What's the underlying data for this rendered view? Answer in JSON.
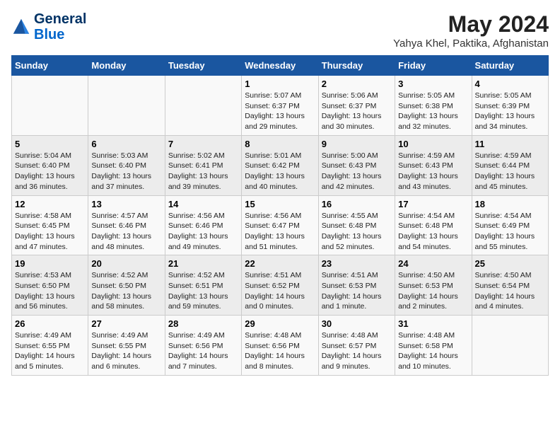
{
  "logo": {
    "line1": "General",
    "line2": "Blue"
  },
  "title": "May 2024",
  "subtitle": "Yahya Khel, Paktika, Afghanistan",
  "days_of_week": [
    "Sunday",
    "Monday",
    "Tuesday",
    "Wednesday",
    "Thursday",
    "Friday",
    "Saturday"
  ],
  "weeks": [
    [
      {
        "day": "",
        "content": ""
      },
      {
        "day": "",
        "content": ""
      },
      {
        "day": "",
        "content": ""
      },
      {
        "day": "1",
        "content": "Sunrise: 5:07 AM\nSunset: 6:37 PM\nDaylight: 13 hours\nand 29 minutes."
      },
      {
        "day": "2",
        "content": "Sunrise: 5:06 AM\nSunset: 6:37 PM\nDaylight: 13 hours\nand 30 minutes."
      },
      {
        "day": "3",
        "content": "Sunrise: 5:05 AM\nSunset: 6:38 PM\nDaylight: 13 hours\nand 32 minutes."
      },
      {
        "day": "4",
        "content": "Sunrise: 5:05 AM\nSunset: 6:39 PM\nDaylight: 13 hours\nand 34 minutes."
      }
    ],
    [
      {
        "day": "5",
        "content": "Sunrise: 5:04 AM\nSunset: 6:40 PM\nDaylight: 13 hours\nand 36 minutes."
      },
      {
        "day": "6",
        "content": "Sunrise: 5:03 AM\nSunset: 6:40 PM\nDaylight: 13 hours\nand 37 minutes."
      },
      {
        "day": "7",
        "content": "Sunrise: 5:02 AM\nSunset: 6:41 PM\nDaylight: 13 hours\nand 39 minutes."
      },
      {
        "day": "8",
        "content": "Sunrise: 5:01 AM\nSunset: 6:42 PM\nDaylight: 13 hours\nand 40 minutes."
      },
      {
        "day": "9",
        "content": "Sunrise: 5:00 AM\nSunset: 6:43 PM\nDaylight: 13 hours\nand 42 minutes."
      },
      {
        "day": "10",
        "content": "Sunrise: 4:59 AM\nSunset: 6:43 PM\nDaylight: 13 hours\nand 43 minutes."
      },
      {
        "day": "11",
        "content": "Sunrise: 4:59 AM\nSunset: 6:44 PM\nDaylight: 13 hours\nand 45 minutes."
      }
    ],
    [
      {
        "day": "12",
        "content": "Sunrise: 4:58 AM\nSunset: 6:45 PM\nDaylight: 13 hours\nand 47 minutes."
      },
      {
        "day": "13",
        "content": "Sunrise: 4:57 AM\nSunset: 6:46 PM\nDaylight: 13 hours\nand 48 minutes."
      },
      {
        "day": "14",
        "content": "Sunrise: 4:56 AM\nSunset: 6:46 PM\nDaylight: 13 hours\nand 49 minutes."
      },
      {
        "day": "15",
        "content": "Sunrise: 4:56 AM\nSunset: 6:47 PM\nDaylight: 13 hours\nand 51 minutes."
      },
      {
        "day": "16",
        "content": "Sunrise: 4:55 AM\nSunset: 6:48 PM\nDaylight: 13 hours\nand 52 minutes."
      },
      {
        "day": "17",
        "content": "Sunrise: 4:54 AM\nSunset: 6:48 PM\nDaylight: 13 hours\nand 54 minutes."
      },
      {
        "day": "18",
        "content": "Sunrise: 4:54 AM\nSunset: 6:49 PM\nDaylight: 13 hours\nand 55 minutes."
      }
    ],
    [
      {
        "day": "19",
        "content": "Sunrise: 4:53 AM\nSunset: 6:50 PM\nDaylight: 13 hours\nand 56 minutes."
      },
      {
        "day": "20",
        "content": "Sunrise: 4:52 AM\nSunset: 6:50 PM\nDaylight: 13 hours\nand 58 minutes."
      },
      {
        "day": "21",
        "content": "Sunrise: 4:52 AM\nSunset: 6:51 PM\nDaylight: 13 hours\nand 59 minutes."
      },
      {
        "day": "22",
        "content": "Sunrise: 4:51 AM\nSunset: 6:52 PM\nDaylight: 14 hours\nand 0 minutes."
      },
      {
        "day": "23",
        "content": "Sunrise: 4:51 AM\nSunset: 6:53 PM\nDaylight: 14 hours\nand 1 minute."
      },
      {
        "day": "24",
        "content": "Sunrise: 4:50 AM\nSunset: 6:53 PM\nDaylight: 14 hours\nand 2 minutes."
      },
      {
        "day": "25",
        "content": "Sunrise: 4:50 AM\nSunset: 6:54 PM\nDaylight: 14 hours\nand 4 minutes."
      }
    ],
    [
      {
        "day": "26",
        "content": "Sunrise: 4:49 AM\nSunset: 6:55 PM\nDaylight: 14 hours\nand 5 minutes."
      },
      {
        "day": "27",
        "content": "Sunrise: 4:49 AM\nSunset: 6:55 PM\nDaylight: 14 hours\nand 6 minutes."
      },
      {
        "day": "28",
        "content": "Sunrise: 4:49 AM\nSunset: 6:56 PM\nDaylight: 14 hours\nand 7 minutes."
      },
      {
        "day": "29",
        "content": "Sunrise: 4:48 AM\nSunset: 6:56 PM\nDaylight: 14 hours\nand 8 minutes."
      },
      {
        "day": "30",
        "content": "Sunrise: 4:48 AM\nSunset: 6:57 PM\nDaylight: 14 hours\nand 9 minutes."
      },
      {
        "day": "31",
        "content": "Sunrise: 4:48 AM\nSunset: 6:58 PM\nDaylight: 14 hours\nand 10 minutes."
      },
      {
        "day": "",
        "content": ""
      }
    ]
  ]
}
